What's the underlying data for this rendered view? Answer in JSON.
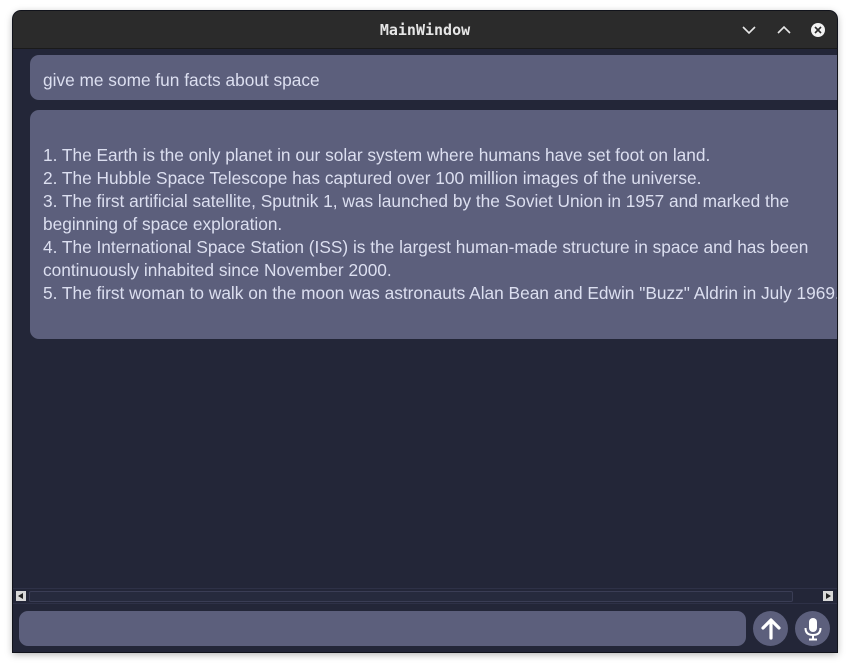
{
  "window": {
    "title": "MainWindow",
    "buttons": {
      "minimize": "chevron-down-icon",
      "maximize": "chevron-up-icon",
      "close": "close-icon"
    }
  },
  "chat": {
    "user_message": "give me some fun facts about space",
    "assistant_facts": [
      "1. The Earth is the only planet in our solar system where humans have set foot on land.",
      "2. The Hubble Space Telescope has captured over 100 million images of the universe.",
      "3. The first artificial satellite, Sputnik 1, was launched by the Soviet Union in 1957 and marked the beginning of space exploration.",
      "4. The International Space Station (ISS) is the largest human-made structure in space and has been continuously inhabited since November 2000.",
      "5. The first woman to walk on the moon was astronauts Alan Bean and Edwin \"Buzz\" Aldrin in July 1969."
    ]
  },
  "composer": {
    "input_value": "",
    "input_placeholder": "",
    "send_icon": "arrow-up-icon",
    "mic_icon": "microphone-icon"
  },
  "colors": {
    "background": "#232638",
    "bubble": "#5c5f7c",
    "text": "#dcdff0",
    "titlebar": "#2b2b2b"
  }
}
